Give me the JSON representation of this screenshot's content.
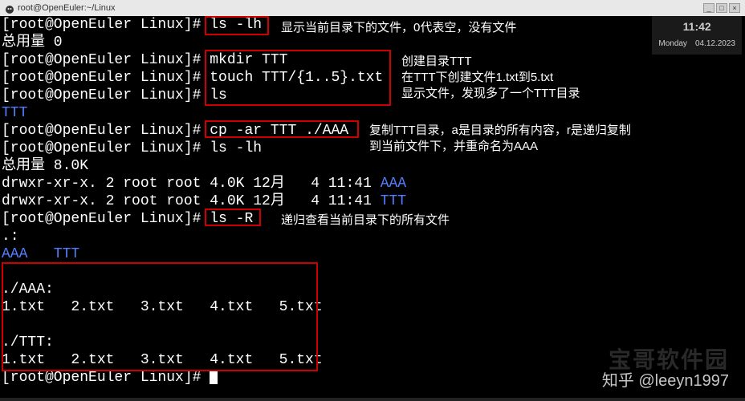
{
  "window": {
    "title": "root@OpenEuler:~/Linux",
    "min": "_",
    "max": "□",
    "close": "×"
  },
  "clock": {
    "time": "11:42",
    "day": "Monday",
    "date": "04.12.2023"
  },
  "prompt": "[root@OpenEuler Linux]# ",
  "cmds": {
    "ls_lh": "ls -lh",
    "total0": "总用量 0",
    "mkdir": "mkdir TTT",
    "touch": "touch TTT/{1..5}.txt",
    "ls": "ls",
    "ttt": "TTT",
    "cp": "cp -ar TTT ./AAA",
    "ls_lh2": "ls -lh",
    "total8": "总用量 8.0K",
    "perm1": "drwxr-xr-x. 2 root root 4.0K 12月   4 11:41 ",
    "aaa": "AAA",
    "perm2": "drwxr-xr-x. 2 root root 4.0K 12月   4 11:41 ",
    "ttt2": "TTT",
    "lsR": "ls -R",
    "dot": ".:",
    "aaa_ttt": "AAA   TTT",
    "dirAAA": "./AAA:",
    "files": "1.txt   2.txt   3.txt   4.txt   5.txt",
    "dirTTT": "./TTT:"
  },
  "annotations": {
    "a1": "显示当前目录下的文件，0代表空，没有文件",
    "a2a": "创建目录TTT",
    "a2b": "在TTT下创建文件1.txt到5.txt",
    "a2c": "显示文件，发现多了一个TTT目录",
    "a3a": "复制TTT目录，a是目录的所有内容，r是递归复制",
    "a3b": "到当前文件下，并重命名为AAA",
    "a4": "递归查看当前目录下的所有文件"
  },
  "watermark": {
    "zhihu": "知乎 @leeyn1997",
    "cn": "宝哥软件园"
  }
}
